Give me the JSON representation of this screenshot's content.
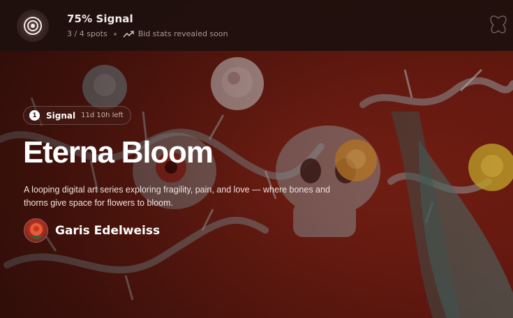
{
  "topbar": {
    "title": "75% Signal",
    "spots": "3 / 4 spots",
    "bid_stats": "Bid stats revealed soon",
    "icons": [
      "signal-icon",
      "trending-up-icon",
      "butterfly-icon"
    ]
  },
  "hero": {
    "chip": {
      "number": "1",
      "label": "Signal",
      "time_left": "11d 10h left"
    },
    "title": "Eterna Bloom",
    "description": "A looping digital art series exploring fragility, pain, and love — where bones and thorns give space for flowers to bloom.",
    "artist": {
      "name": "Garis Edelweiss"
    }
  },
  "colors": {
    "background": "#6e1a12",
    "topbar": "#1e100e",
    "text": "#ffffff",
    "muted_text": "#a99895"
  }
}
